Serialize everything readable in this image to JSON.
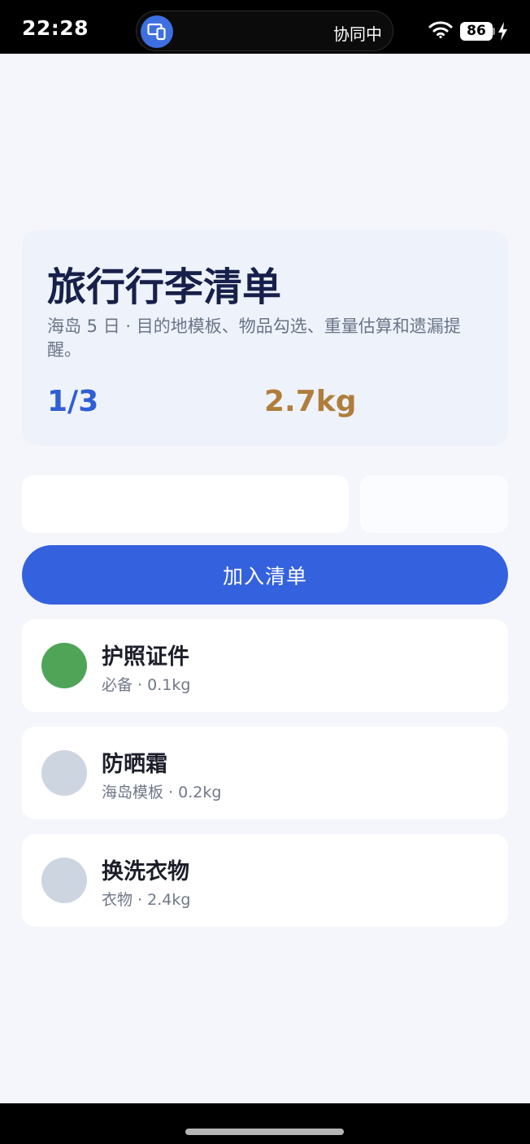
{
  "status_bar": {
    "time": "22:28",
    "collab_label": "协同中",
    "battery_level": "86",
    "icons": [
      "screen-share-icon",
      "wifi-icon",
      "battery-icon",
      "charging-icon"
    ]
  },
  "header": {
    "title": "旅行行李清单",
    "subtitle": "海岛 5 日 · 目的地模板、物品勾选、重量估算和遗漏提醒。",
    "progress": "1/3",
    "total_weight": "2.7kg"
  },
  "form": {
    "item_value": "",
    "weight_value": "",
    "add_label": "加入清单"
  },
  "items": [
    {
      "name": "护照证件",
      "meta": "必备 · 0.1kg",
      "checked": true
    },
    {
      "name": "防晒霜",
      "meta": "海岛模板 · 0.2kg",
      "checked": false
    },
    {
      "name": "换洗衣物",
      "meta": "衣物 · 2.4kg",
      "checked": false
    }
  ],
  "colors": {
    "accent": "#3461de",
    "progress": "#2f5fd4",
    "weight": "#b07e3c",
    "checked": "#4fa458",
    "unchecked": "#cdd5e1"
  }
}
